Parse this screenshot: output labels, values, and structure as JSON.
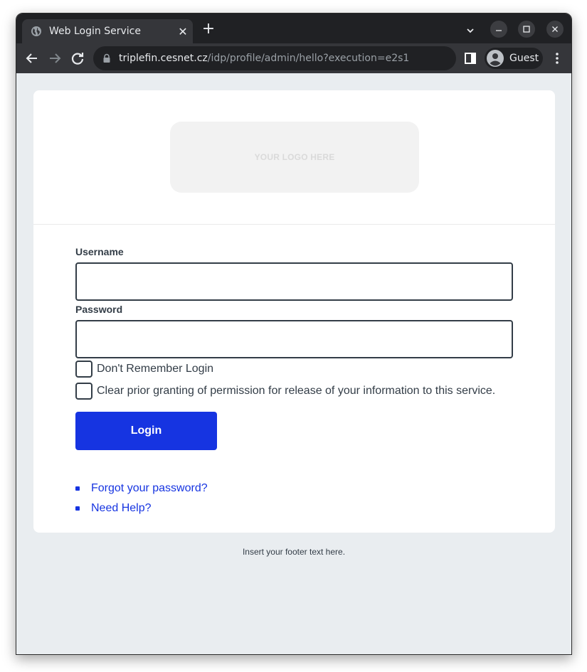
{
  "browser": {
    "tab": {
      "title": "Web Login Service",
      "favicon": "globe-icon",
      "close": "✕"
    },
    "new_tab": "+",
    "url": {
      "host": "triplefin.cesnet.cz",
      "path": "/idp/profile/admin/hello?execution=e2s1"
    },
    "profile": {
      "label": "Guest",
      "icon": "person-icon"
    },
    "icons": [
      "back-arrow-icon",
      "forward-arrow-icon",
      "reload-icon",
      "lock-icon",
      "side-panel-icon",
      "kebab-menu-icon",
      "tab-search-chevron-icon",
      "minimize-icon",
      "maximize-icon",
      "close-icon"
    ]
  },
  "page": {
    "logo_text": "YOUR LOGO HERE",
    "form": {
      "username": {
        "label": "Username",
        "value": "",
        "placeholder": ""
      },
      "password": {
        "label": "Password",
        "value": "",
        "placeholder": ""
      },
      "checkboxes": [
        {
          "label": "Don't Remember Login",
          "checked": false
        },
        {
          "label": "Clear prior granting of permission for release of your information to this service.",
          "checked": false
        }
      ],
      "login_label": "Login"
    },
    "links": [
      {
        "label": "Forgot your password?"
      },
      {
        "label": "Need Help?"
      }
    ],
    "footer": "Insert your footer text here."
  },
  "colors": {
    "accent": "#1634e1",
    "text": "#333d47",
    "page_bg": "#e9edf0",
    "card_bg": "#ffffff",
    "logo_bg": "#f2f2f2"
  }
}
